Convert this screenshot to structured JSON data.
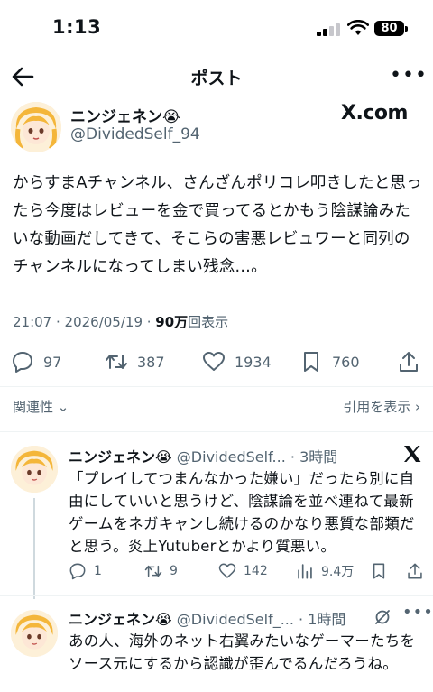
{
  "status_bar": {
    "time": "1:13",
    "battery": "80"
  },
  "nav": {
    "title": "ポスト",
    "more": "•••"
  },
  "post": {
    "author_name": "ニンジェネン😭",
    "author_handle": "@DividedSelf_94",
    "source_badge": "X.com",
    "text": "からすまAチャンネル、さんざんポリコレ叩きしたと思ったら今度はレビューを金で買ってるとかもう陰謀論みたいな動画だしてきて、そこらの害悪レビュワーと同列のチャンネルになってしまい残念…。",
    "meta_time": "21:07 · 2026/05/19 · ",
    "views_count": "90万",
    "views_label": "回表示",
    "replies": "97",
    "reposts": "387",
    "likes": "1934",
    "bookmarks": "760"
  },
  "filters": {
    "related": "関連性 ⌄",
    "quotes": "引用を表示 ›"
  },
  "replies": [
    {
      "name": "ニンジェネン😭",
      "handle": "@DividedSelf...",
      "time": " · 3時間",
      "text": "「プレイしてつまんなかった嫌い」だったら別に自由にしていいと思うけど、陰謀論を並べ連ねて最新ゲームをネガキャンし続けるのかなり悪質な部類だと思う。炎上Yutuberとかより質悪い。",
      "replies": "1",
      "reposts": "9",
      "likes": "142",
      "views": "9.4万"
    },
    {
      "name": "ニンジェネン😭",
      "handle": "@DividedSelf_...",
      "time": " · 1時間",
      "text": "あの人、海外のネット右翼みたいなゲーマーたちをソース元にするから認識が歪んでるんだろうね。",
      "more": "•••"
    }
  ]
}
